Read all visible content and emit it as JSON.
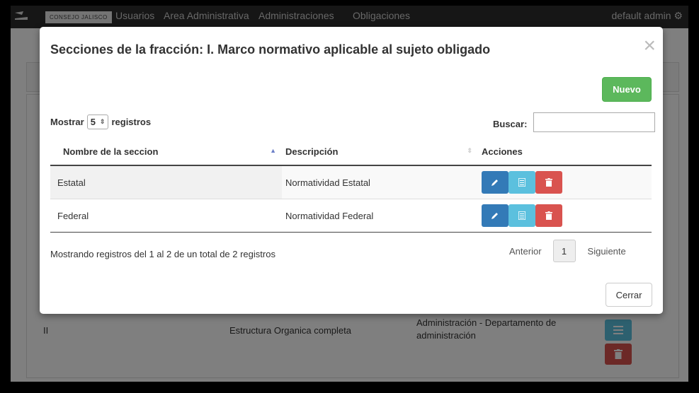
{
  "navbar": {
    "brand": "CONSEJO JALISCO",
    "links": [
      "Usuarios",
      "Area Administrativa",
      "Administraciones",
      "Obligaciones"
    ],
    "user": "default admin"
  },
  "background_table": {
    "row": {
      "num": "II",
      "name": "Estructura Organica completa",
      "description": "Administración - Departamento de administración"
    }
  },
  "modal": {
    "title": "Secciones de la fracción: I. Marco normativo aplicable al sujeto obligado",
    "new_button": "Nuevo",
    "length": {
      "prefix": "Mostrar",
      "value": "5",
      "suffix": "registros"
    },
    "search": {
      "label": "Buscar:",
      "value": ""
    },
    "columns": [
      "Nombre de la seccion",
      "Descripción",
      "Acciones"
    ],
    "rows": [
      {
        "name": "Estatal",
        "description": "Normatividad Estatal"
      },
      {
        "name": "Federal",
        "description": "Normatividad Federal"
      }
    ],
    "info": "Mostrando registros del 1 al 2 de un total de 2 registros",
    "pagination": {
      "prev": "Anterior",
      "page": "1",
      "next": "Siguiente"
    },
    "close_button": "Cerrar"
  },
  "colors": {
    "primary": "#337ab7",
    "info": "#5bc0de",
    "danger": "#d9534f",
    "success": "#5cb85c"
  },
  "icons": {
    "edit": "pencil-icon",
    "view": "list-icon",
    "delete": "trash-icon",
    "close": "close-icon"
  }
}
